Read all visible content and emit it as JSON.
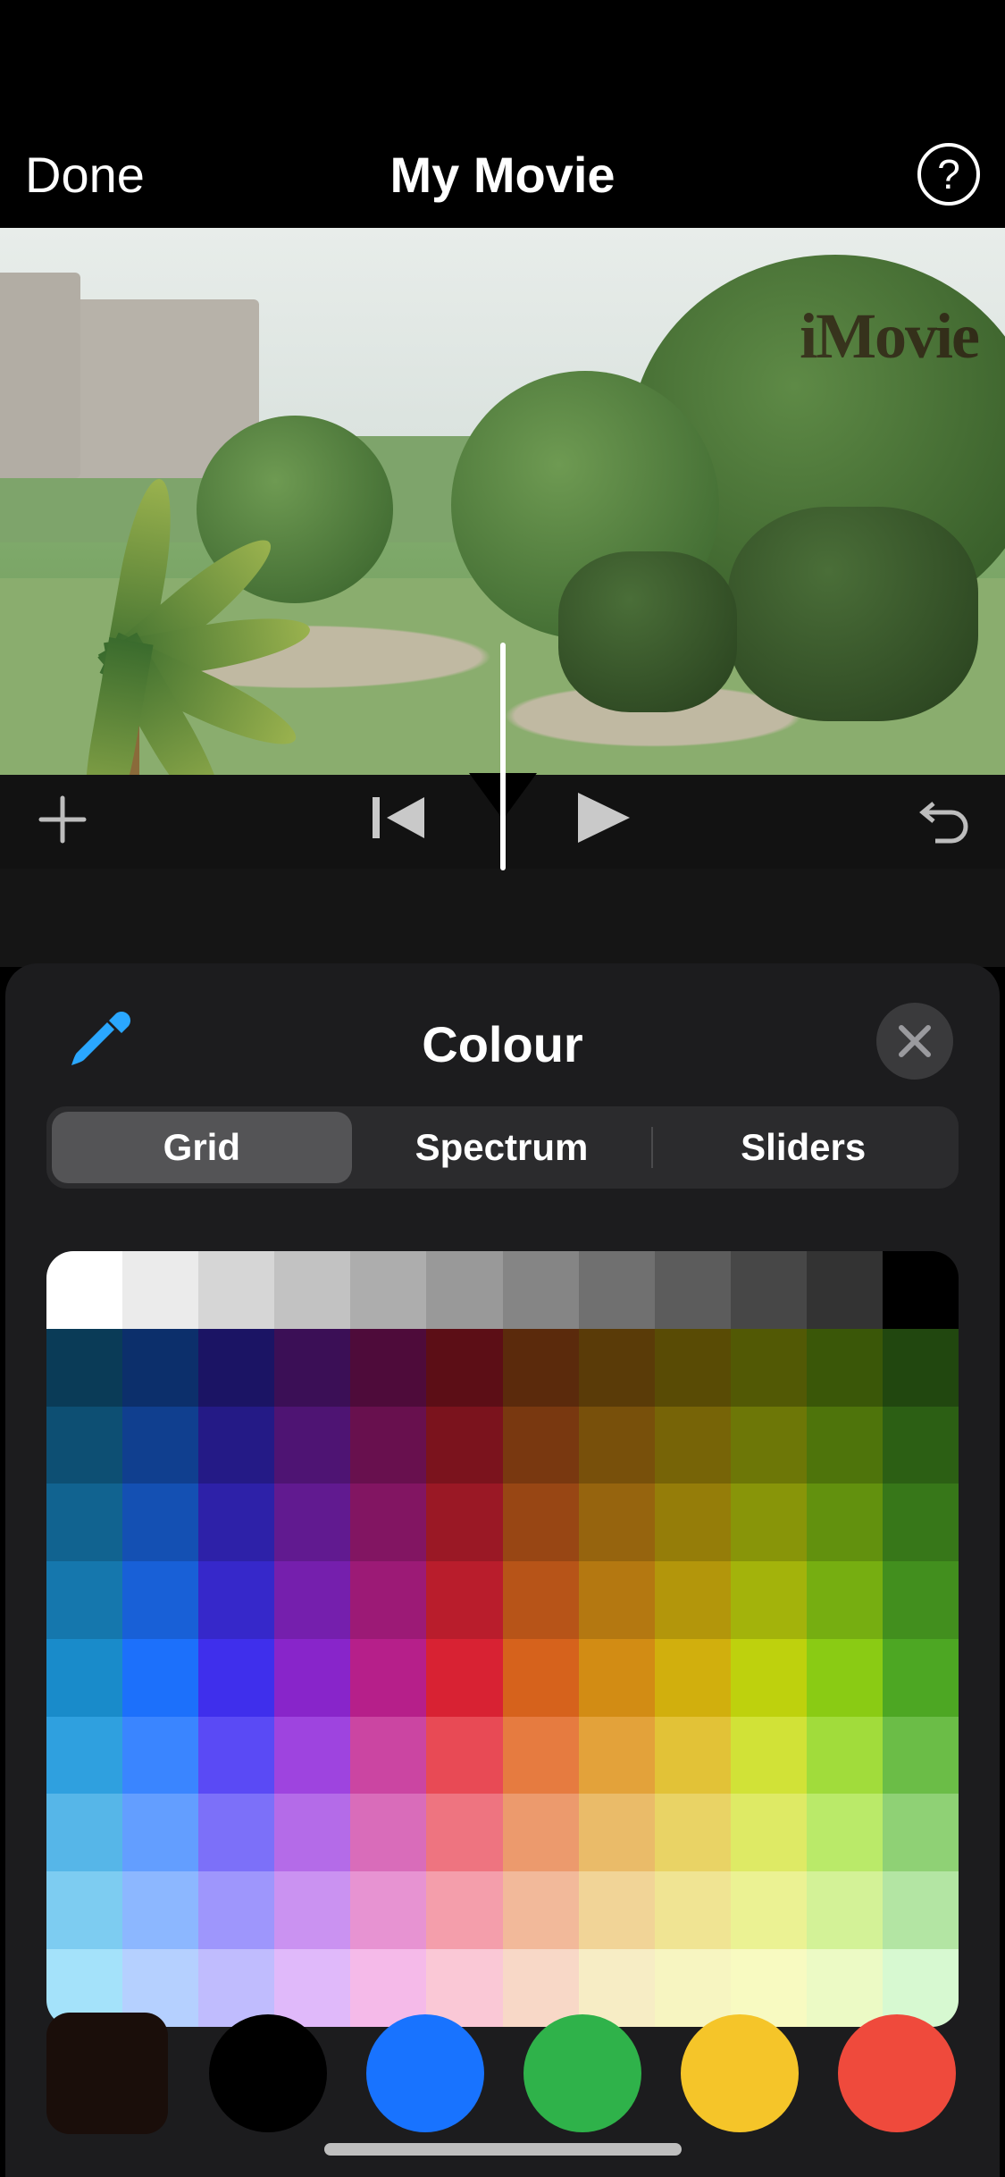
{
  "nav": {
    "done": "Done",
    "title": "My Movie",
    "help_glyph": "?"
  },
  "preview": {
    "watermark": "iMovie"
  },
  "panel": {
    "title": "Colour",
    "tabs": {
      "grid": "Grid",
      "spectrum": "Spectrum",
      "sliders": "Sliders"
    }
  },
  "grid_colors": [
    [
      "#ffffff",
      "#ebebeb",
      "#d6d6d6",
      "#c2c2c2",
      "#adadad",
      "#999999",
      "#858585",
      "#707070",
      "#5c5c5c",
      "#474747",
      "#333333",
      "#000000"
    ],
    [
      "#0a3b57",
      "#0c2f6b",
      "#1b1464",
      "#3b0f56",
      "#4e0b3a",
      "#5c0e16",
      "#5b2a0c",
      "#5a3b08",
      "#594b05",
      "#525905",
      "#3a5708",
      "#21470f"
    ],
    [
      "#0d4f73",
      "#103f8f",
      "#241a86",
      "#4e1473",
      "#68104e",
      "#7b131d",
      "#793810",
      "#78500b",
      "#776407",
      "#6d7707",
      "#4e740b",
      "#2c5f14"
    ],
    [
      "#116390",
      "#1450b3",
      "#2d21a8",
      "#611a90",
      "#821562",
      "#9a1825",
      "#984614",
      "#96640e",
      "#957d09",
      "#889509",
      "#62910e",
      "#377719"
    ],
    [
      "#1577ad",
      "#1860d7",
      "#3628ca",
      "#751fad",
      "#9c1a76",
      "#b91d2c",
      "#b75418",
      "#b47811",
      "#b3960b",
      "#a3b30b",
      "#76ae11",
      "#428f1e"
    ],
    [
      "#198bca",
      "#1c70fb",
      "#3f2fec",
      "#8825ca",
      "#b61f8a",
      "#d82233",
      "#d6621c",
      "#d28c14",
      "#d1af0d",
      "#bed10d",
      "#8acb14",
      "#4da723"
    ],
    [
      "#2fa0df",
      "#3a85ff",
      "#5a4af5",
      "#9e44df",
      "#cb45a2",
      "#e84a55",
      "#e67b40",
      "#e3a23a",
      "#e2c237",
      "#d1e237",
      "#a1dc3b",
      "#6bbd47"
    ],
    [
      "#56b6e8",
      "#639eff",
      "#7c70f9",
      "#b46be8",
      "#d96cba",
      "#ee7480",
      "#ec9a6d",
      "#eabb69",
      "#e9d365",
      "#deea65",
      "#baea69",
      "#8fd175"
    ],
    [
      "#7dccf1",
      "#8cb7ff",
      "#9e96fc",
      "#ca92f1",
      "#e793d2",
      "#f49eab",
      "#f2b99a",
      "#f1d497",
      "#f0e493",
      "#ebf293",
      "#d3f297",
      "#b3e5a3"
    ],
    [
      "#a4e2fa",
      "#b5d0ff",
      "#c0bcfe",
      "#e0b9fa",
      "#f5bae9",
      "#fac8d6",
      "#f8d8c7",
      "#f7edc5",
      "#f7f5c1",
      "#f8fac1",
      "#ecfac5",
      "#d7f9d1"
    ]
  ],
  "recent": {
    "box": "#1a0e0a",
    "circles": [
      "#000000",
      "#1873ff",
      "#2fb24a",
      "#f5c529",
      "#ef4a3c"
    ]
  }
}
